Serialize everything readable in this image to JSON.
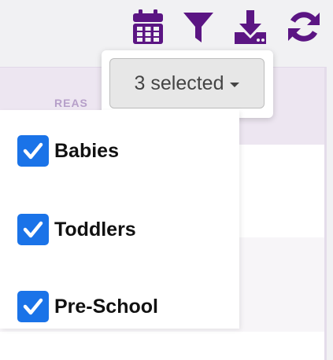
{
  "toolbar": {
    "icons": [
      "calendar-icon",
      "filter-icon",
      "download-icon",
      "refresh-icon"
    ],
    "icon_color": "#5b1583"
  },
  "table": {
    "column_header": "REAS"
  },
  "selector": {
    "label": "3 selected"
  },
  "dropdown": {
    "options": [
      {
        "label": "Babies",
        "checked": true
      },
      {
        "label": "Toddlers",
        "checked": true
      },
      {
        "label": "Pre-School",
        "checked": true
      }
    ]
  },
  "colors": {
    "checkbox": "#1a73e8",
    "header_bg": "#ede6f1",
    "header_text": "#b69fc9"
  }
}
